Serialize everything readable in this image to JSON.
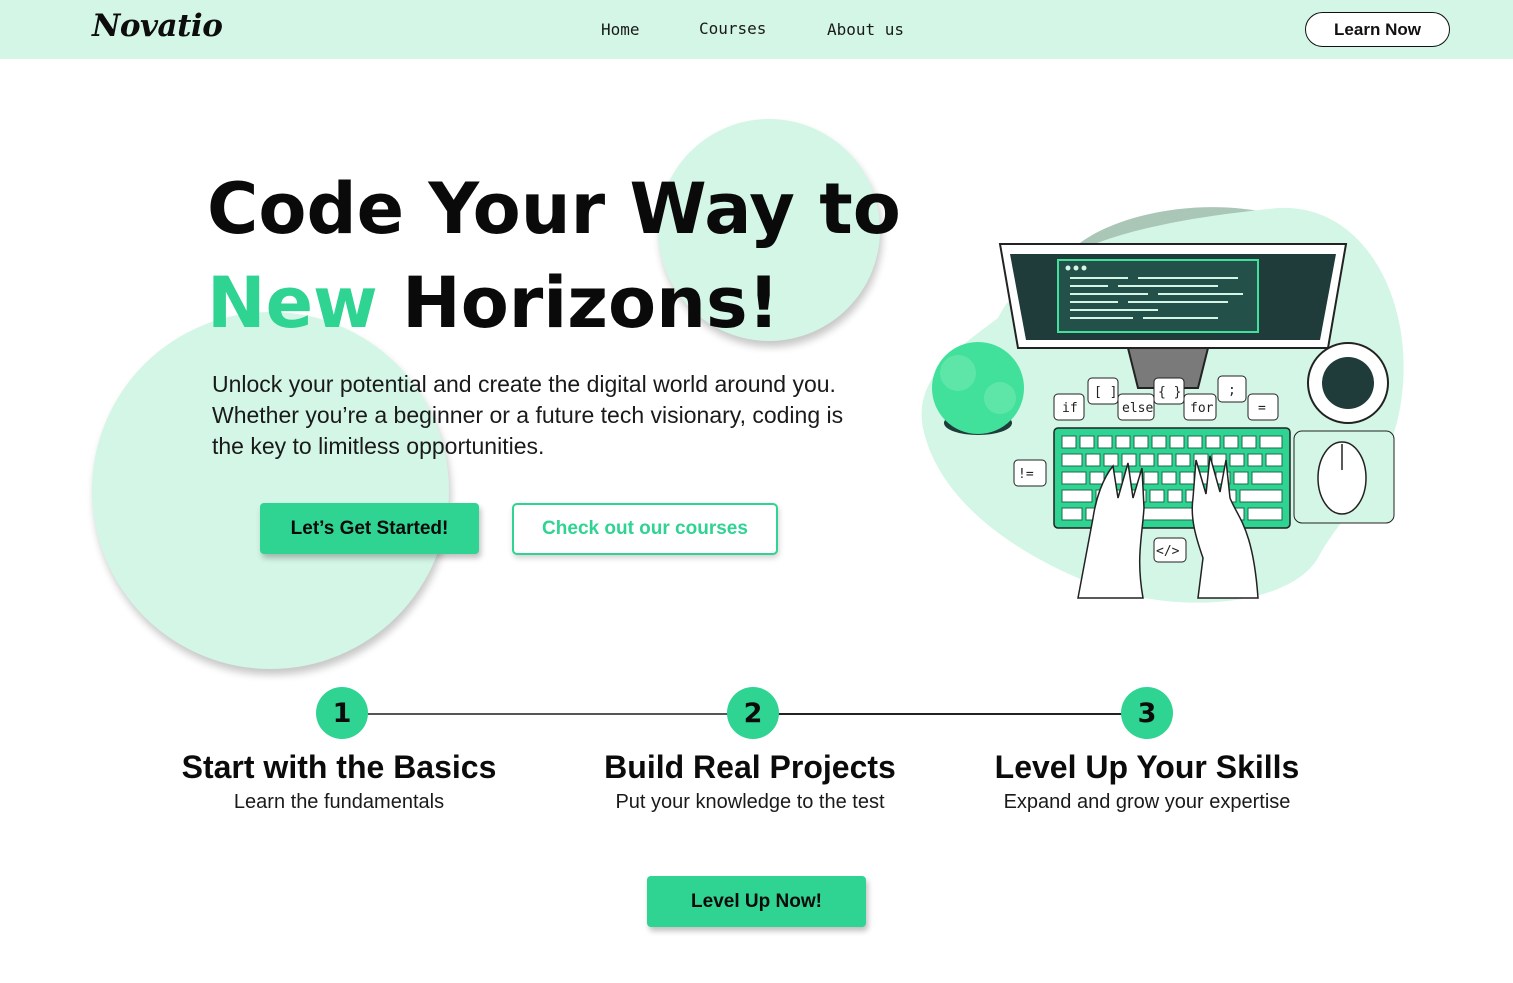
{
  "nav": {
    "logo": "Novatio",
    "links": [
      "Home",
      "Courses",
      "About us"
    ],
    "cta_label": "Learn Now"
  },
  "hero": {
    "headline_line1": "Code Your Way to",
    "headline_accent": "New",
    "headline_rest": "Horizons!",
    "subtext": "Unlock your potential and create the digital world around you. Whether you’re a beginner or a future tech visionary, coding is the key to limitless opportunities.",
    "primary_button": "Let’s Get Started!",
    "secondary_button": "Check out our courses",
    "illustration_code_tokens": [
      "if",
      "[ ]",
      "else",
      "{ }",
      "for",
      ";",
      "=",
      "!=",
      "</>"
    ]
  },
  "steps": [
    {
      "number": "1",
      "title": "Start with the Basics",
      "subtitle": "Learn the fundamentals"
    },
    {
      "number": "2",
      "title": "Build Real Projects",
      "subtitle": "Put your knowledge to the test"
    },
    {
      "number": "3",
      "title": "Level Up Your Skills",
      "subtitle": "Expand and grow your expertise"
    }
  ],
  "bottom_cta": "Level Up Now!",
  "colors": {
    "accent": "#2fd392",
    "nav_background": "#d3f6e6",
    "circle_fill": "#d3f6e6",
    "text": "#0b0b0b"
  }
}
